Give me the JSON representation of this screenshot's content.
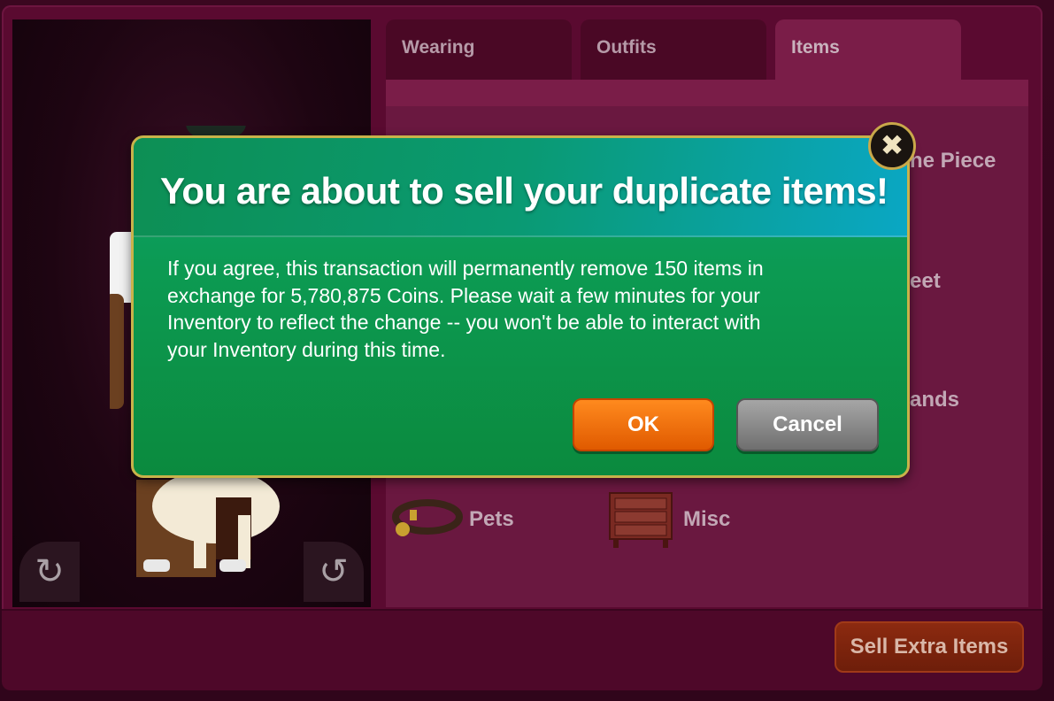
{
  "tabs": [
    {
      "label": "Wearing",
      "active": false
    },
    {
      "label": "Outfits",
      "active": false
    },
    {
      "label": "Items",
      "active": true
    }
  ],
  "categories": {
    "one_piece": "ne Piece",
    "feet": "eet",
    "hands": "ands",
    "pets": "Pets",
    "misc": "Misc"
  },
  "avatar_controls": {
    "rotate_left_icon": "rotate-left-icon",
    "rotate_right_icon": "rotate-right-icon"
  },
  "footer": {
    "sell_button_label": "Sell Extra Items"
  },
  "dialog": {
    "title": "You are about to sell your duplicate items!",
    "body_lines": [
      "If you agree, this transaction will permanently remove 150 items in",
      "exchange for 5,780,875 Coins. Please wait a few minutes for your",
      "Inventory to reflect the change -- you won't be able to interact with",
      "your Inventory during this time."
    ],
    "ok_label": "OK",
    "cancel_label": "Cancel",
    "close_icon": "close-icon"
  },
  "colors": {
    "background": "#5a0a30",
    "dialog_green": "#0c9a52",
    "dialog_border": "#c8b24a",
    "ok_orange": "#f07010",
    "cancel_gray": "#8a8a8a"
  }
}
